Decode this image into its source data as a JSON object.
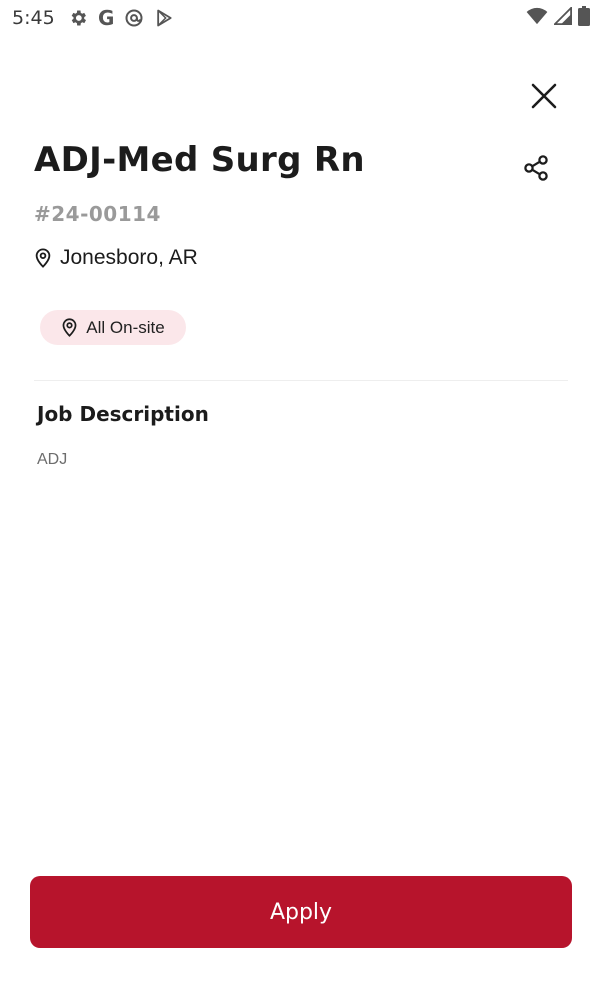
{
  "status_bar": {
    "time": "5:45",
    "left_icons": [
      "gear-icon",
      "google-icon",
      "at-sign-icon",
      "play-store-icon"
    ],
    "g_label": "G",
    "right_icons": [
      "wifi-icon",
      "cell-signal-icon",
      "battery-icon"
    ]
  },
  "job": {
    "title": "ADJ-Med Surg Rn",
    "id": "#24-00114",
    "location": "Jonesboro, AR",
    "work_type": "All On-site"
  },
  "description": {
    "heading": "Job Description",
    "body": "ADJ"
  },
  "actions": {
    "apply_label": "Apply"
  },
  "colors": {
    "accent": "#b7142c",
    "chip_bg": "#fbe7ea",
    "id_gray": "#9a9a9a"
  }
}
